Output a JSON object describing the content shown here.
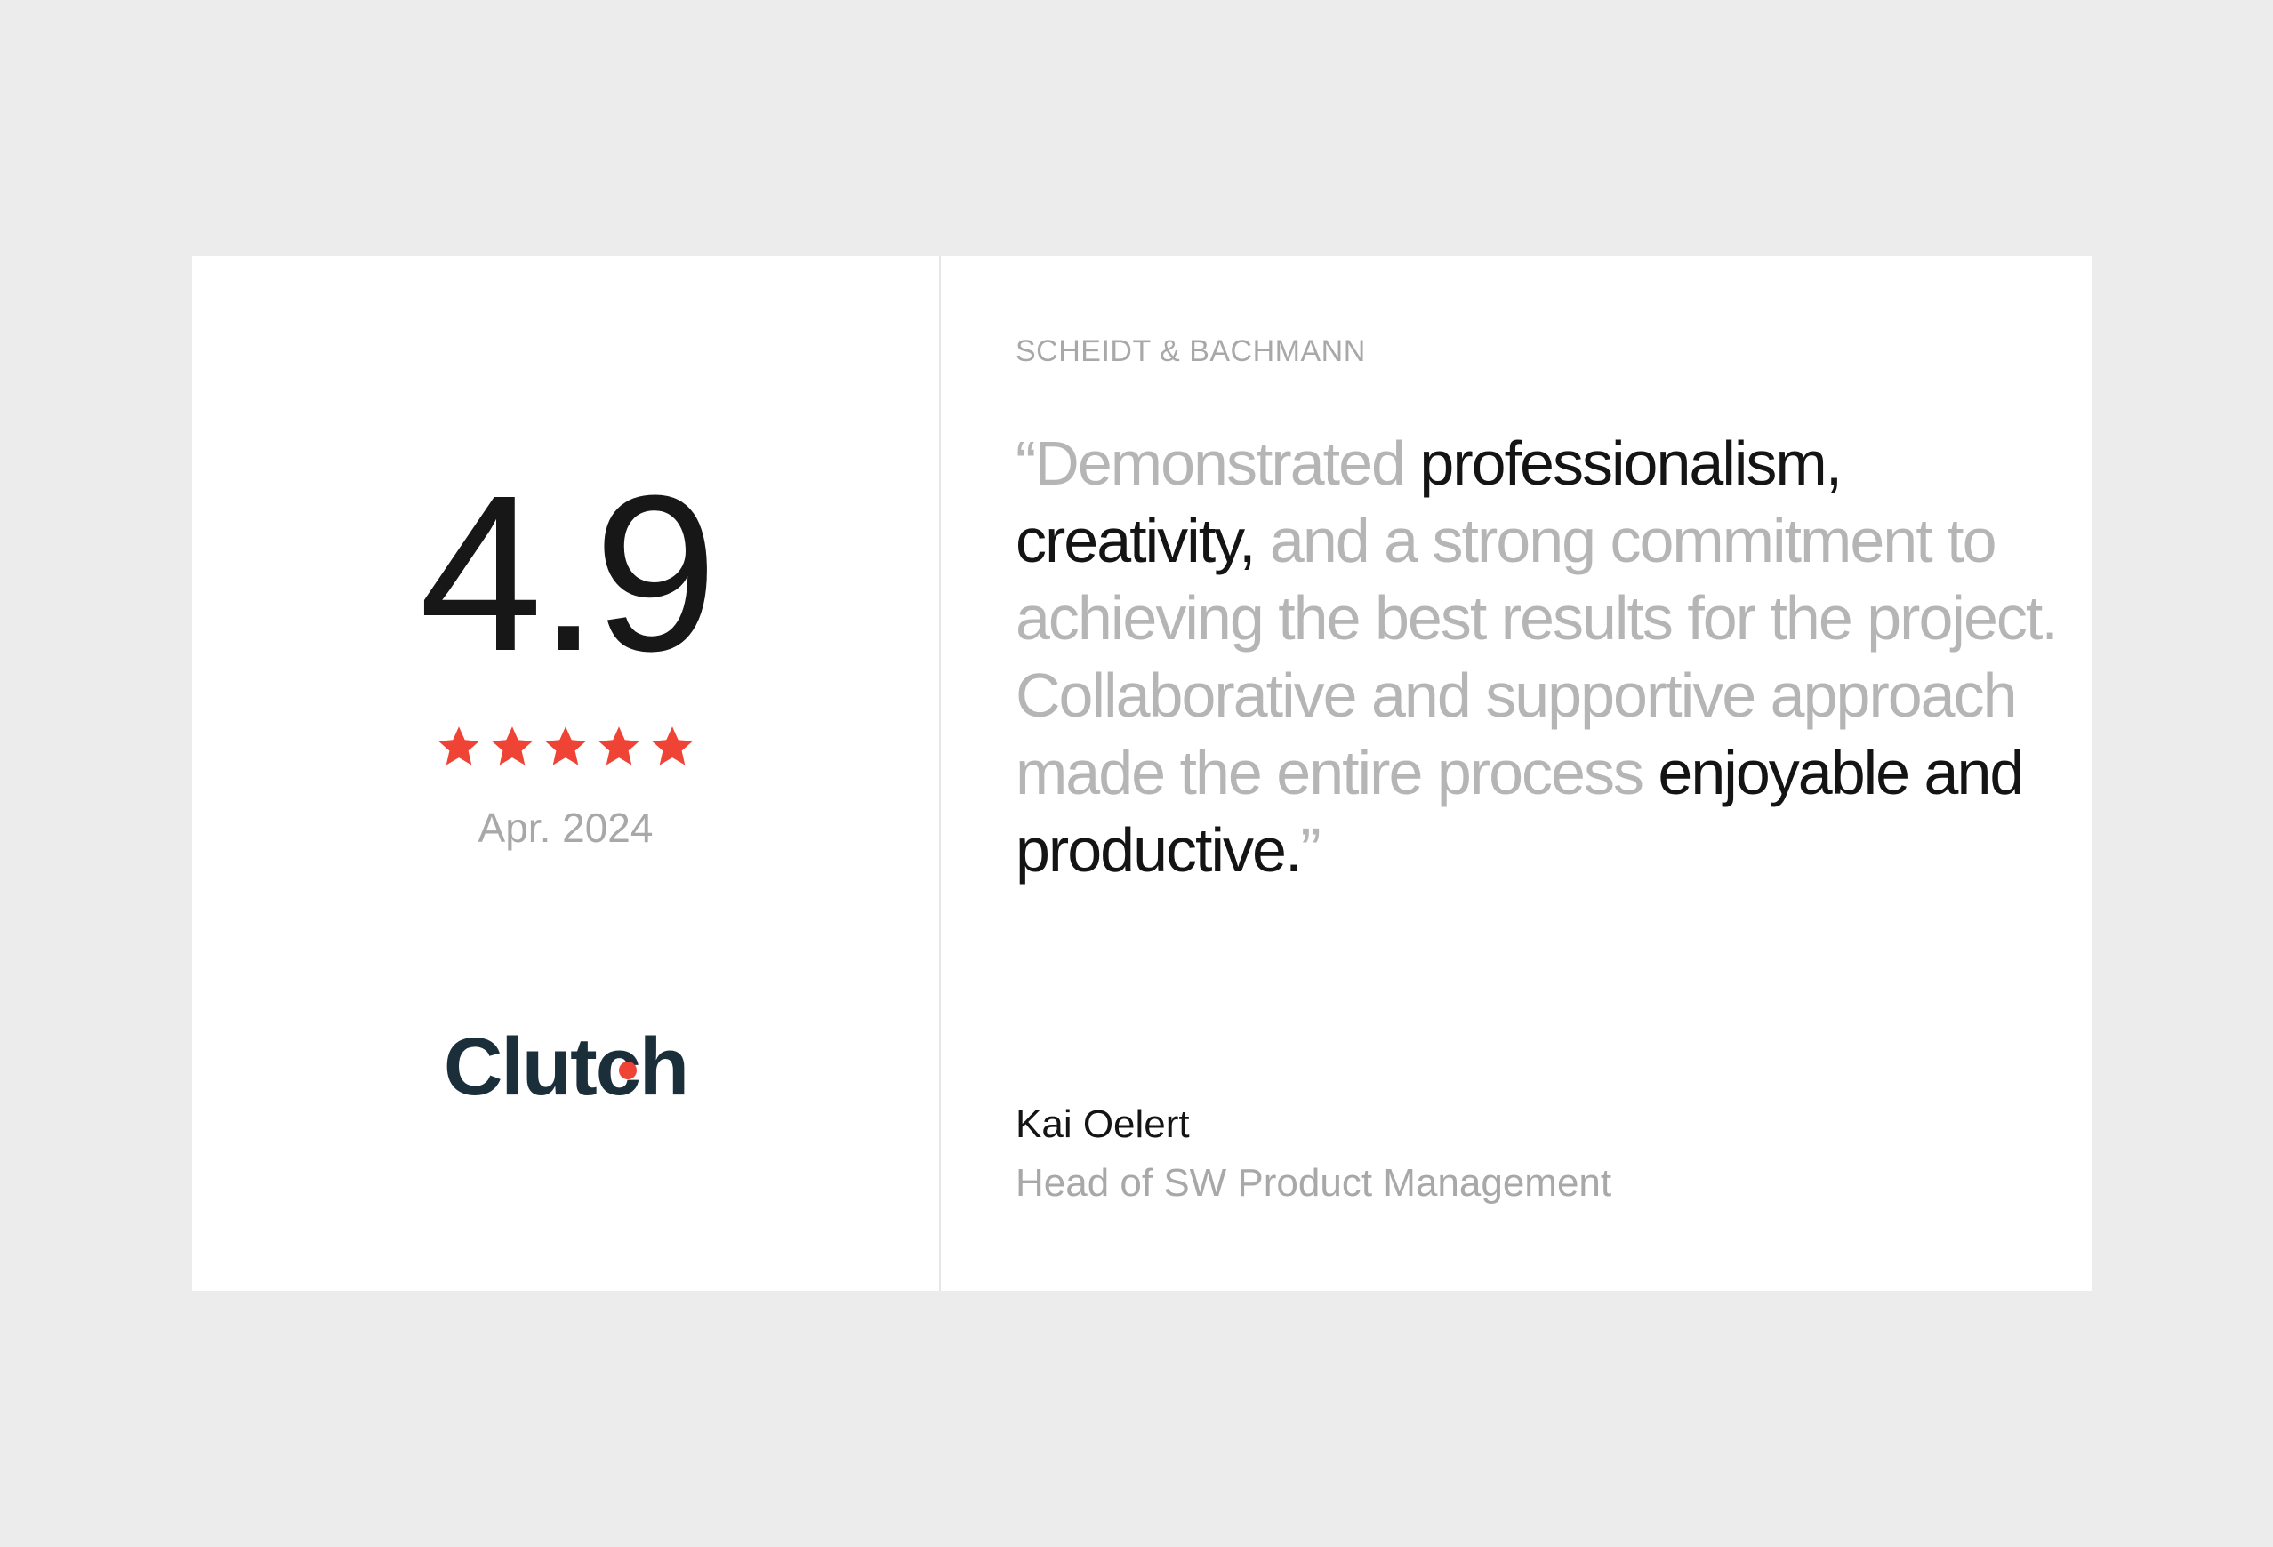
{
  "colors": {
    "background": "#ececec",
    "card": "#ffffff",
    "star": "#ef4335",
    "muted_text": "#b5b5b5",
    "strong_text": "#141414",
    "logo": "#1b2f3a"
  },
  "rating": {
    "score": "4.9",
    "stars": 5,
    "star_icon": "star-icon",
    "date": "Apr. 2024"
  },
  "logo": {
    "text_before": "Clut",
    "text_c": "c",
    "text_after": "h"
  },
  "review": {
    "company": "SCHEIDT & BACHMANN",
    "quote": {
      "part1": "“Demonstrated ",
      "part2": "professionalism, creativity,",
      "part3": " and a strong commitment to achieving the best results for the project. Collaborative and supportive approach made the entire process ",
      "part4": "enjoyable and productive.",
      "part5": "”"
    },
    "author_name": "Kai Oelert",
    "author_role": "Head of SW Product Management"
  }
}
